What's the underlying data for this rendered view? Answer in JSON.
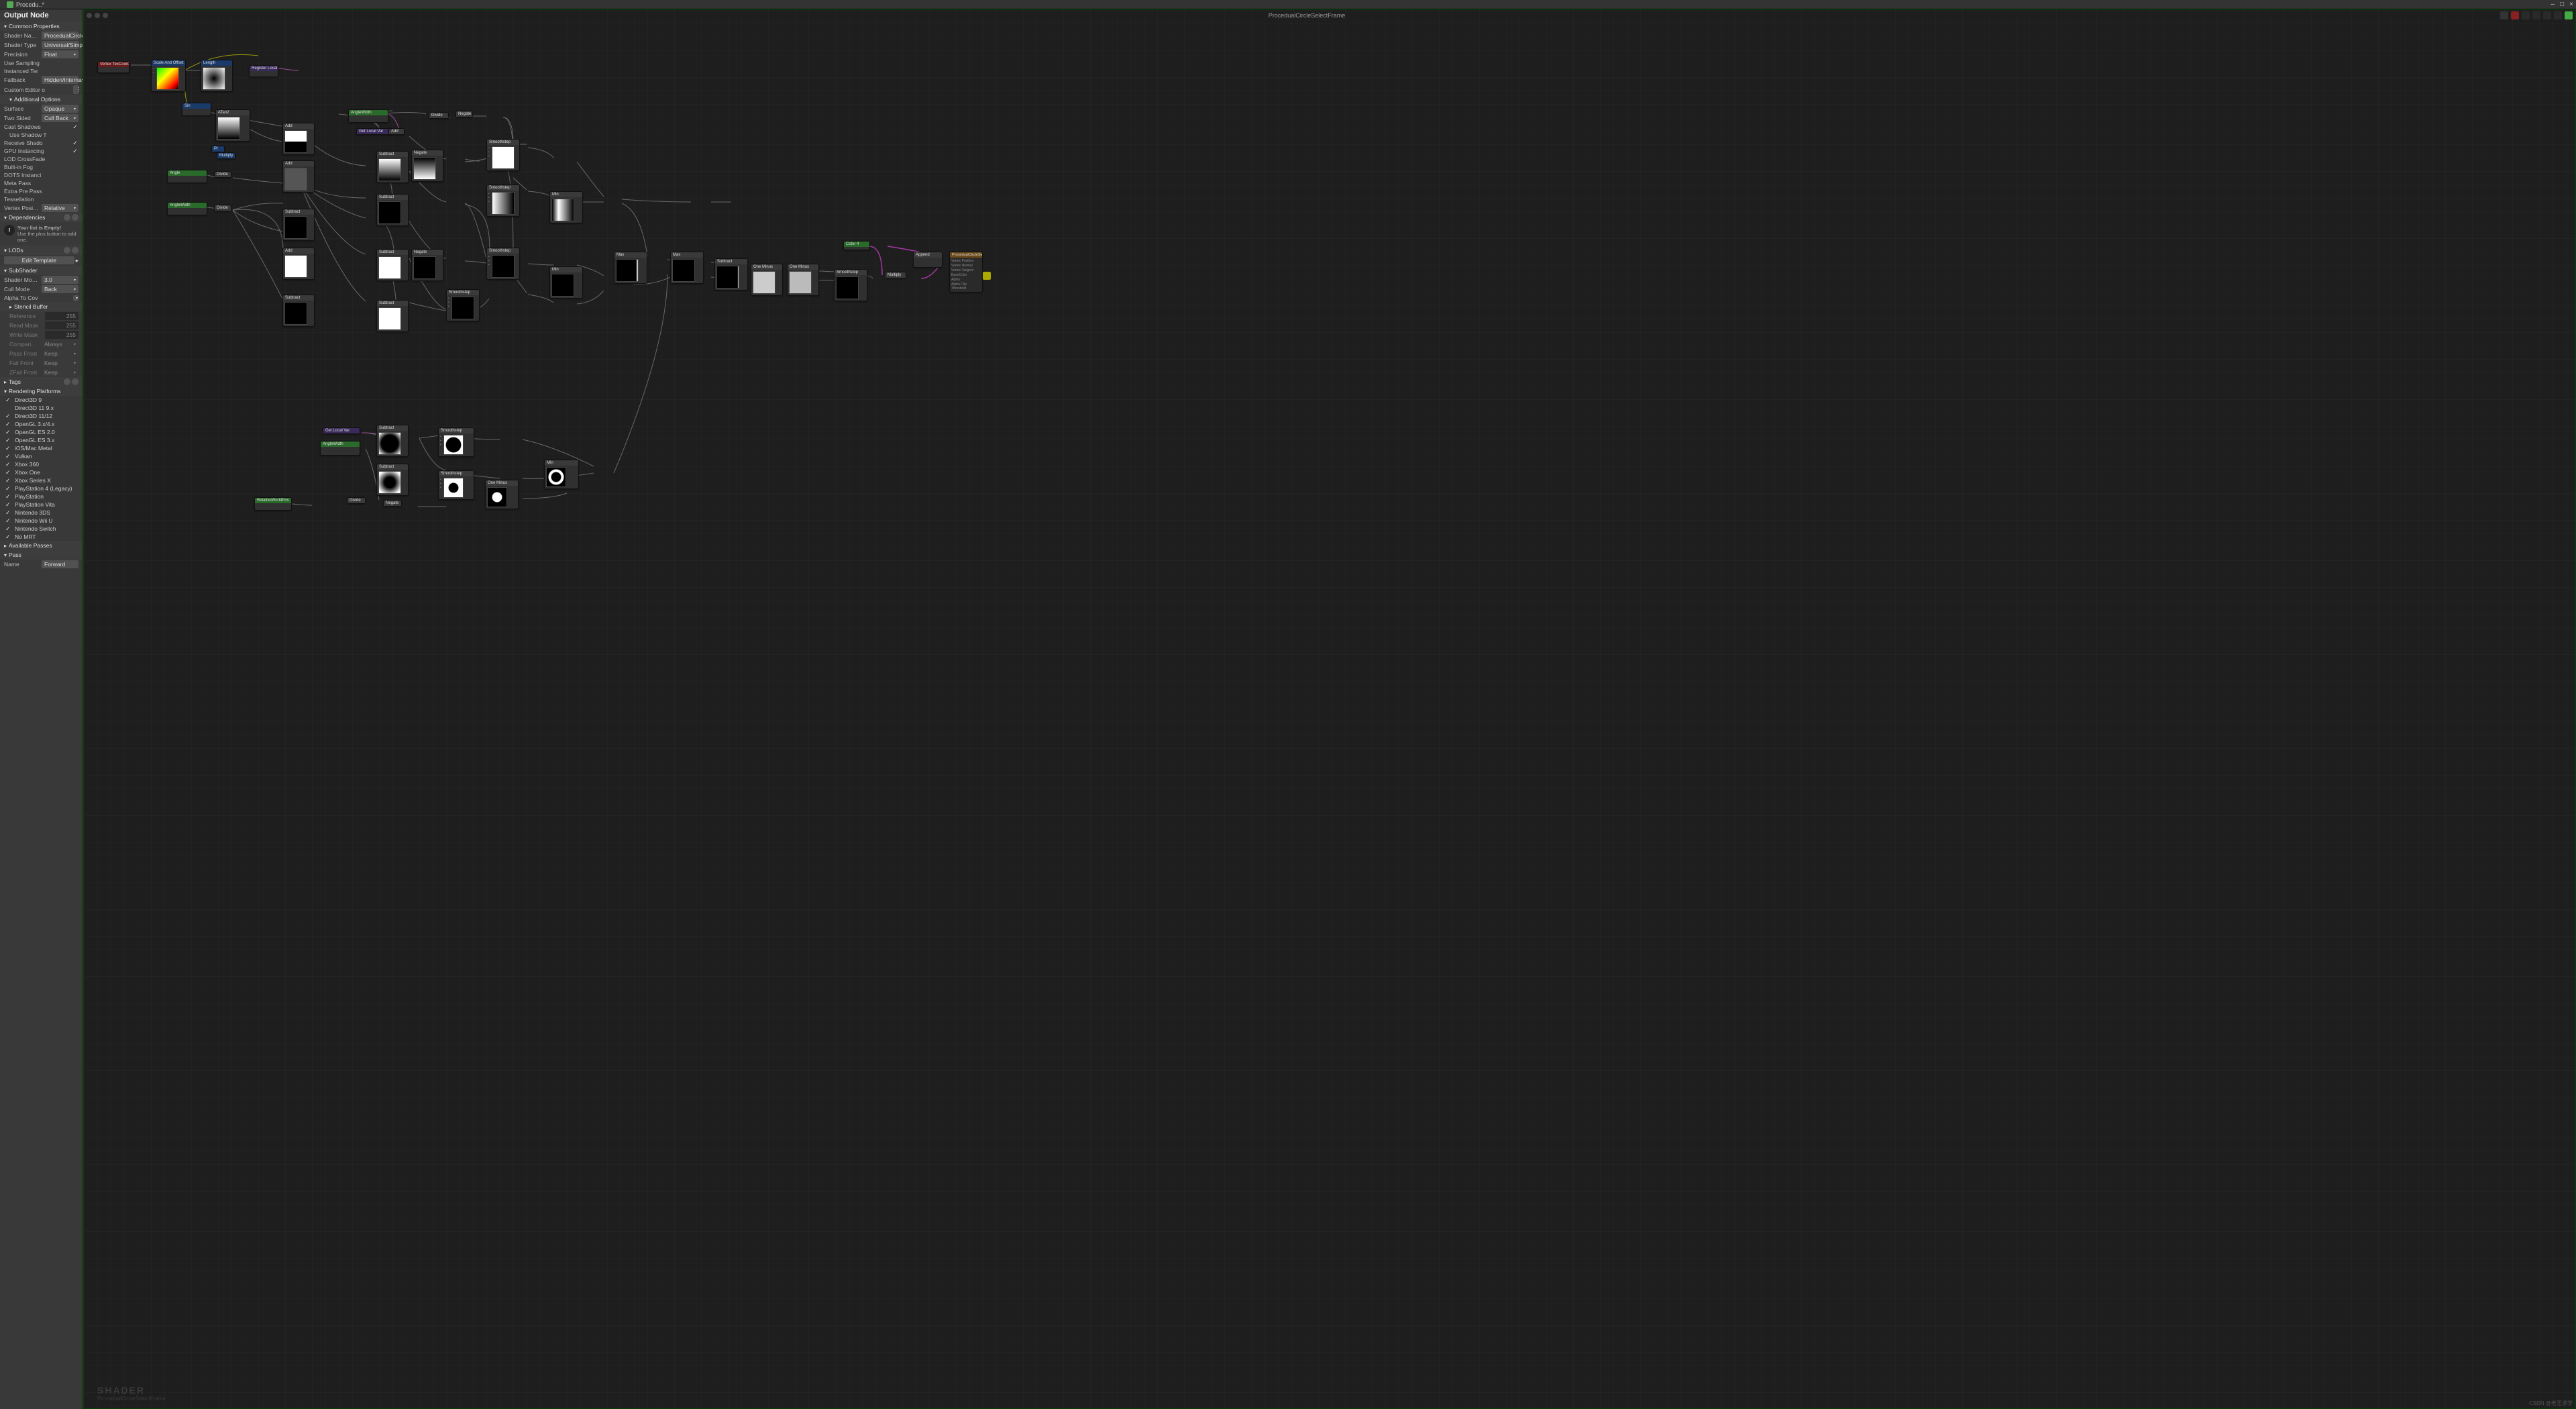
{
  "window": {
    "tab_title": "Procedu..*",
    "minimize": "–",
    "maximize": "□",
    "close": "×"
  },
  "canvas": {
    "title": "ProceduаlCircleSelectFrame",
    "watermark_big": "SHADER",
    "watermark_small": "ProceduаlCircleSelectFrame",
    "csdn": "CSDN @老王求学"
  },
  "sidebar": {
    "header": "Output Node",
    "common": {
      "title": "Common Properties",
      "shader_name_label": "Shader Name",
      "shader_name_value": "ProceduаlCircleS",
      "shader_type_label": "Shader Type",
      "shader_type_value": "Universal/Simp",
      "precision_label": "Precision",
      "precision_value": "Float",
      "use_sampling_label": "Use Sampling",
      "instanced_ter_label": "Instanced Ter",
      "fallback_label": "Fallback",
      "fallback_value": "Hidden/Interna",
      "custom_editor_label": "Custom Editor o",
      "additional_options": "Additional Options",
      "surface_label": "Surface",
      "surface_value": "Opaque",
      "two_sided_label": "Two Sided",
      "two_sided_value": "Cull Back",
      "cast_shadows_label": "Cast Shadows",
      "use_shadow_t_label": "Use Shadow T",
      "receive_shado_label": "Receive Shado",
      "gpu_instancing_label": "GPU Instancing",
      "lod_crossfade_label": "LOD CrossFade",
      "builtin_fog_label": "Built-in Fog",
      "dots_instancing_label": "DOTS Instanci",
      "meta_pass_label": "Meta Pass",
      "extra_pre_pass_label": "Extra Pre Pass",
      "tessellation_label": "Tessellation",
      "vertex_position_label": "Vertex Position",
      "vertex_position_value": "Relative"
    },
    "dependencies": {
      "title": "Dependencies",
      "empty_title": "Your list is Empty!",
      "empty_text": "Use the plus button to add one."
    },
    "lods": {
      "title": "LODs",
      "edit_template": "Edit Template"
    },
    "subshader": {
      "title": "SubShader",
      "shader_model_label": "Shader Model",
      "shader_model_value": "3.0",
      "cull_mode_label": "Cull Mode",
      "cull_mode_value": "Back",
      "alpha_to_cov_label": "Alpha To Cov"
    },
    "stencil": {
      "title": "Stencil Buffer",
      "reference_label": "Reference",
      "reference_value": "255",
      "read_mask_label": "Read Mask",
      "read_mask_value": "255",
      "write_mask_label": "Write Mask",
      "write_mask_value": "255",
      "comparison_label": "Comparison",
      "comparison_value": "Always",
      "pass_front_label": "Pass Front",
      "pass_front_value": "Keep",
      "fail_front_label": "Fail Front",
      "fail_front_value": "Keep",
      "zfail_front_label": "ZFail Front",
      "zfail_front_value": "Keep"
    },
    "tags": {
      "title": "Tags"
    },
    "platforms": {
      "title": "Rendering Platforms",
      "items": [
        {
          "label": "Direct3D 9",
          "checked": true
        },
        {
          "label": "Direct3D 11 9.x",
          "checked": false
        },
        {
          "label": "Direct3D 11/12",
          "checked": true
        },
        {
          "label": "OpenGL 3.x/4.x",
          "checked": true
        },
        {
          "label": "OpenGL ES 2.0",
          "checked": true
        },
        {
          "label": "OpenGL ES 3.x",
          "checked": true
        },
        {
          "label": "iOS/Mac Metal",
          "checked": true
        },
        {
          "label": "Vulkan",
          "checked": true
        },
        {
          "label": "Xbox 360",
          "checked": true
        },
        {
          "label": "Xbox One",
          "checked": true
        },
        {
          "label": "Xbox Series X",
          "checked": true
        },
        {
          "label": "PlayStation 4 (Legacy)",
          "checked": true
        },
        {
          "label": "PlayStation",
          "checked": true
        },
        {
          "label": "PlayStation Vita",
          "checked": true
        },
        {
          "label": "Nintendo 3DS",
          "checked": true
        },
        {
          "label": "Nintendo Wii U",
          "checked": true
        },
        {
          "label": "Nintendo Switch",
          "checked": true
        },
        {
          "label": "No MRT",
          "checked": true
        }
      ]
    },
    "available_passes": {
      "title": "Available Passes"
    },
    "pass": {
      "title": "Pass",
      "name_label": "Name",
      "name_value": "Forward"
    }
  },
  "nodes": {
    "vertex": "Vertex TexCoord",
    "scaleoffset": "Scale And Offset",
    "length": "Length",
    "registerlocal": "Register Local Var",
    "sin": "Sin",
    "atan2": "ATan2",
    "pi": "PI",
    "multiply": "Multiply",
    "add": "Add",
    "subtract": "Subtract",
    "one": "One",
    "divide": "Divide",
    "negate": "Negate",
    "angle": "Angle",
    "anglewidth": "AngleWidth",
    "smoothstep": "Smoothstep",
    "min": "Min",
    "max": "Max",
    "oneminus": "One Minus",
    "getlocal": "Get Local Var",
    "color": "Color 4",
    "append": "Append",
    "rwv": "RelativeWorldPos",
    "master": "ProceduаlCircleSelectFra",
    "master_f1": "Vertex Position",
    "master_f2": "Vertex Normal",
    "master_f3": "Vertex Tangent",
    "master_f4": "BaseColor",
    "master_f5": "Alpha",
    "master_f6": "Alpha Clip Threshold"
  }
}
